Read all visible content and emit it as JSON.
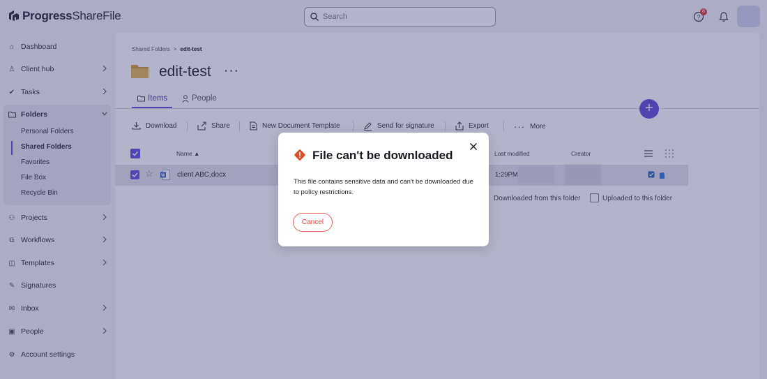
{
  "header": {
    "logo_bold": "Progress",
    "logo_light": "ShareFile",
    "search_placeholder": "Search",
    "notification_count": "8"
  },
  "sidebar": {
    "items": [
      {
        "label": "Dashboard",
        "icon": "home-icon"
      },
      {
        "label": "Client hub",
        "icon": "client-hub-icon"
      },
      {
        "label": "Tasks",
        "icon": "check-icon"
      },
      {
        "label": "Folders",
        "icon": "folder-icon"
      },
      {
        "label": "Projects",
        "icon": "projects-icon"
      },
      {
        "label": "Workflows",
        "icon": "workflow-icon"
      },
      {
        "label": "Templates",
        "icon": "template-icon"
      },
      {
        "label": "Signatures",
        "icon": "pen-icon"
      },
      {
        "label": "Inbox",
        "icon": "inbox-icon"
      },
      {
        "label": "People",
        "icon": "people-icon"
      },
      {
        "label": "Account settings",
        "icon": "account-icon"
      }
    ],
    "folder_subitems": [
      "Personal Folders",
      "Shared Folders",
      "Favorites",
      "File Box",
      "Recycle Bin"
    ]
  },
  "main": {
    "breadcrumb": {
      "parent": "Shared Folders",
      "separator": ">",
      "current": "edit-test"
    },
    "title": "edit-test",
    "title_more": "···",
    "tabs": [
      {
        "label": "Items"
      },
      {
        "label": "People"
      }
    ],
    "toolbar": [
      "Download",
      "Share",
      "New Document Template",
      "Send for signature",
      "Export",
      "More"
    ],
    "columns": {
      "name": "Name ▲",
      "last_modified": "Last modified",
      "creator": "Creator"
    },
    "rows": [
      {
        "name": "client ABC.docx",
        "time": "1:29PM"
      }
    ],
    "filters": [
      "Downloaded from this folder",
      "Uploaded to this folder"
    ],
    "fab": "+"
  },
  "modal": {
    "title": "File can't be downloaded",
    "body": "This file contains sensitive data and can't be downloaded due to policy restrictions.",
    "cancel": "Cancel"
  },
  "colors": {
    "accent": "#5a4bd6",
    "warning": "#d6502a",
    "cancel": "#e04848"
  }
}
